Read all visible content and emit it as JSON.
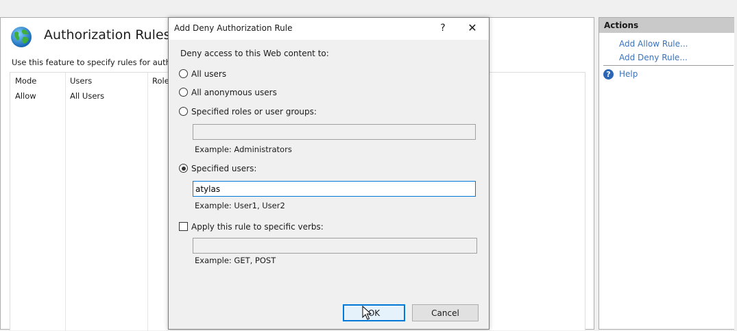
{
  "main": {
    "title": "Authorization Rules",
    "description": "Use this feature to specify rules for authoriz",
    "columns": [
      "Mode",
      "Users",
      "Role"
    ],
    "rows": [
      {
        "mode": "Allow",
        "users": "All Users",
        "roles": ""
      }
    ]
  },
  "actions": {
    "header": "Actions",
    "add_allow": "Add Allow Rule...",
    "add_deny": "Add Deny Rule...",
    "help": "Help",
    "help_icon": "?"
  },
  "dialog": {
    "title": "Add Deny Authorization Rule",
    "help_button": "?",
    "close_button": "✕",
    "prompt": "Deny access to this Web content to:",
    "options": {
      "all_users": "All users",
      "anonymous": "All anonymous users",
      "roles": "Specified roles or user groups:",
      "users": "Specified users:"
    },
    "selected_option": "users",
    "roles_value": "",
    "roles_example": "Example: Administrators",
    "users_value": "atylas",
    "users_example": "Example: User1, User2",
    "verbs_label": "Apply this rule to specific verbs:",
    "verbs_checked": false,
    "verbs_value": "",
    "verbs_example": "Example: GET, POST",
    "ok_label": "OK",
    "cancel_label": "Cancel"
  },
  "colors": {
    "link": "#3a72b8",
    "focus": "#0078d7",
    "header_bg": "#c9c9c9"
  }
}
